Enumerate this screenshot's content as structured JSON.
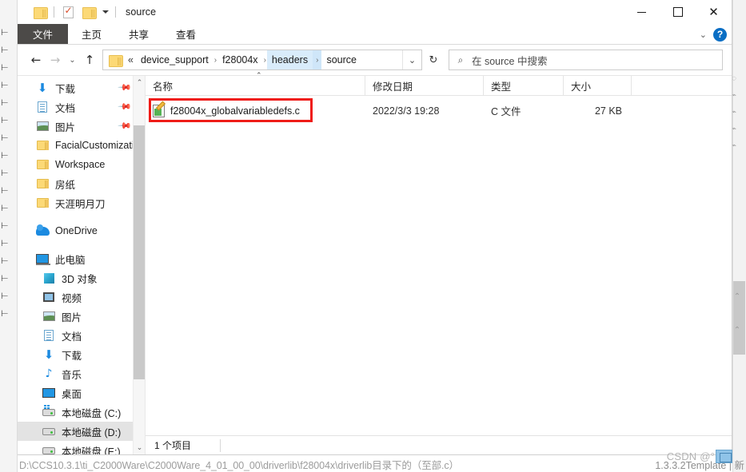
{
  "window": {
    "title": "source",
    "quick_access": [
      {
        "name": "folder-icon",
        "label": "新建文件夹"
      },
      {
        "name": "properties-icon",
        "label": "属性"
      },
      {
        "name": "folder-icon",
        "label": "新建文件夹"
      },
      {
        "name": "chevron-down-icon",
        "label": "自定义快速访问工具栏"
      }
    ],
    "controls": {
      "minimize": "",
      "maximize": "",
      "close": "✕"
    }
  },
  "ribbon": {
    "tabs": [
      {
        "label": "文件",
        "active": true
      },
      {
        "label": "主页",
        "active": false
      },
      {
        "label": "共享",
        "active": false
      },
      {
        "label": "查看",
        "active": false
      }
    ],
    "expand_icon": "⌄",
    "help_label": "?"
  },
  "address": {
    "back_icon": "←",
    "forward_icon": "→",
    "recent_icon": "⌄",
    "up_icon": "↑",
    "folder_icon": "folder-icon",
    "ellipsis": "«",
    "crumbs": [
      {
        "label": "device_support",
        "active": false
      },
      {
        "label": "f28004x",
        "active": false
      },
      {
        "label": "headers",
        "active": true
      },
      {
        "label": "source",
        "active": false
      }
    ],
    "dropdown_icon": "⌄",
    "refresh_icon": "↻"
  },
  "search": {
    "icon": "⌕",
    "placeholder": "在 source 中搜索"
  },
  "sidebar": {
    "groups": [
      {
        "items": [
          {
            "label": "下载",
            "icon": "download-icon",
            "pinned": true,
            "indent": false,
            "selected": false
          },
          {
            "label": "文档",
            "icon": "document-icon",
            "pinned": true,
            "indent": false,
            "selected": false
          },
          {
            "label": "图片",
            "icon": "picture-icon",
            "pinned": true,
            "indent": false,
            "selected": false
          },
          {
            "label": "FacialCustomizatio",
            "icon": "folder-icon",
            "pinned": false,
            "indent": false,
            "selected": false
          },
          {
            "label": "Workspace",
            "icon": "folder-icon",
            "pinned": false,
            "indent": false,
            "selected": false
          },
          {
            "label": "房纸",
            "icon": "folder-icon",
            "pinned": false,
            "indent": false,
            "selected": false
          },
          {
            "label": "天涯明月刀",
            "icon": "folder-icon",
            "pinned": false,
            "indent": false,
            "selected": false
          }
        ]
      },
      {
        "items": [
          {
            "label": "OneDrive",
            "icon": "onedrive-icon",
            "pinned": false,
            "indent": false,
            "selected": false
          }
        ]
      },
      {
        "items": [
          {
            "label": "此电脑",
            "icon": "this-pc-icon",
            "pinned": false,
            "indent": false,
            "selected": false
          },
          {
            "label": "3D 对象",
            "icon": "3d-objects-icon",
            "pinned": false,
            "indent": true,
            "selected": false
          },
          {
            "label": "视频",
            "icon": "video-icon",
            "pinned": false,
            "indent": true,
            "selected": false
          },
          {
            "label": "图片",
            "icon": "picture-icon",
            "pinned": false,
            "indent": true,
            "selected": false
          },
          {
            "label": "文档",
            "icon": "document-icon",
            "pinned": false,
            "indent": true,
            "selected": false
          },
          {
            "label": "下载",
            "icon": "download-icon",
            "pinned": false,
            "indent": true,
            "selected": false
          },
          {
            "label": "音乐",
            "icon": "music-icon",
            "pinned": false,
            "indent": true,
            "selected": false
          },
          {
            "label": "桌面",
            "icon": "desktop-icon",
            "pinned": false,
            "indent": true,
            "selected": false
          },
          {
            "label": "本地磁盘 (C:)",
            "icon": "system-disk-icon",
            "pinned": false,
            "indent": true,
            "selected": false
          },
          {
            "label": "本地磁盘 (D:)",
            "icon": "disk-icon",
            "pinned": false,
            "indent": true,
            "selected": true
          },
          {
            "label": "本地磁盘 (E:)",
            "icon": "disk-icon",
            "pinned": false,
            "indent": true,
            "selected": false
          }
        ]
      }
    ],
    "scrollbar": {
      "up_icon": "⌃",
      "down_icon": "⌄"
    }
  },
  "filelist": {
    "columns": [
      {
        "key": "name",
        "label": "名称"
      },
      {
        "key": "date",
        "label": "修改日期"
      },
      {
        "key": "type",
        "label": "类型"
      },
      {
        "key": "size",
        "label": "大小"
      }
    ],
    "sort_caret": "⌃",
    "rows": [
      {
        "name": "f28004x_globalvariabledefs.c",
        "date": "2022/3/3 19:28",
        "type": "C 文件",
        "size": "27 KB",
        "icon": "c-source-file-icon",
        "highlighted": true
      }
    ]
  },
  "statusbar": {
    "item_count": "1 个项目"
  },
  "annotation": {
    "highlight_color": "#ef1c18"
  },
  "watermark": {
    "text": "CSDN @°",
    "badge": "watermark-badge-icon"
  },
  "background": {
    "left_gutter": "⊢\n⊢\n⊢\n⊢\n⊢\n⊢\n⊢\n⊢\n⊢\n⊢\n⊢\n⊢\n⊢\n⊢\n⊢\n⊢\n⊢",
    "right_gutter": "◌\n⌁\n⌁\n⌁\n⌁\n \n \n \n \n \n \n \n \n ⌃\n \n ⌃",
    "bottom_left": "D:\\CCS10.3.1\\ti_C2000Ware\\C2000Ware_4_01_00_00\\driverlib\\f28004x\\driverlib目录下的（至部.c）",
    "bottom_right": "1.3.3.2Template | 新"
  }
}
